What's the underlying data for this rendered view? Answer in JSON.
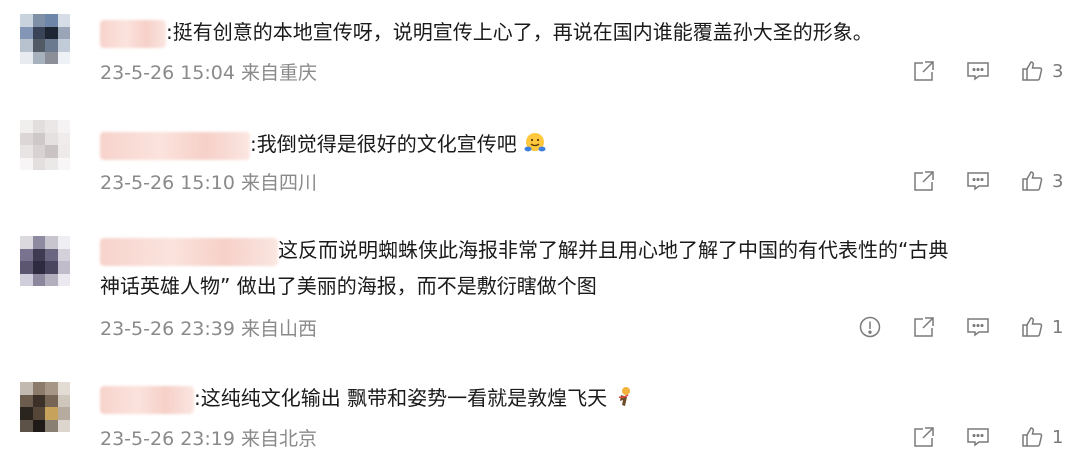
{
  "comments": [
    {
      "text": ":挺有创意的本地宣传呀，说明宣传上心了，再说在国内谁能覆盖孙大圣的形象。",
      "date": "23-5-26 15:04",
      "location": "来自重庆",
      "likes": "3",
      "show_report": false
    },
    {
      "text": ":我倒觉得是很好的文化宣传吧",
      "emoji": "hug-emoji",
      "date": "23-5-26 15:10",
      "location": "来自四川",
      "likes": "3",
      "show_report": false
    },
    {
      "text": "这反而说明蜘蛛侠此海报非常了解并且用心地了解了中国的有代表性的“古典",
      "text_line2": "神话英雄人物” 做出了美丽的海报，而不是敷衍瞎做个图",
      "date": "23-5-26 23:39",
      "location": "来自山西",
      "likes": "1",
      "show_report": true
    },
    {
      "text": ":这纯纯文化输出 飘带和姿势一看就是敦煌飞天",
      "emoji": "dancer-emoji",
      "date": "23-5-26 23:19",
      "location": "来自北京",
      "likes": "1",
      "show_report": false
    }
  ],
  "icons": {
    "share": "share-icon",
    "comment": "comment-icon",
    "like": "thumbs-up-icon",
    "report": "report-icon"
  },
  "colors": {
    "text": "#1a1a1a",
    "meta": "#8a8a8a",
    "icon": "#7a7a7a",
    "name_blur": "#f7d3cc"
  }
}
